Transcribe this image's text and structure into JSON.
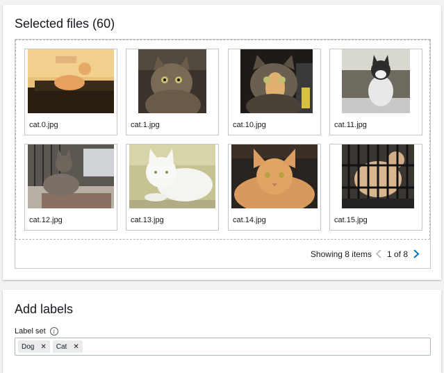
{
  "files_panel": {
    "title": "Selected files (60)",
    "files": [
      {
        "name": "cat.0.jpg"
      },
      {
        "name": "cat.1.jpg"
      },
      {
        "name": "cat.10.jpg"
      },
      {
        "name": "cat.11.jpg"
      },
      {
        "name": "cat.12.jpg"
      },
      {
        "name": "cat.13.jpg"
      },
      {
        "name": "cat.14.jpg"
      },
      {
        "name": "cat.15.jpg"
      }
    ],
    "pagination": {
      "showing": "Showing 8 items",
      "page": "1 of 8",
      "prev_icon": "chevron-left-icon",
      "next_icon": "chevron-right-icon"
    }
  },
  "labels_panel": {
    "title": "Add labels",
    "label_set": "Label set",
    "info_icon": "info-icon",
    "tags": [
      {
        "label": "Dog"
      },
      {
        "label": "Cat"
      }
    ]
  },
  "colors": {
    "accent": "#0073bb",
    "disabled": "#aab7b8"
  }
}
